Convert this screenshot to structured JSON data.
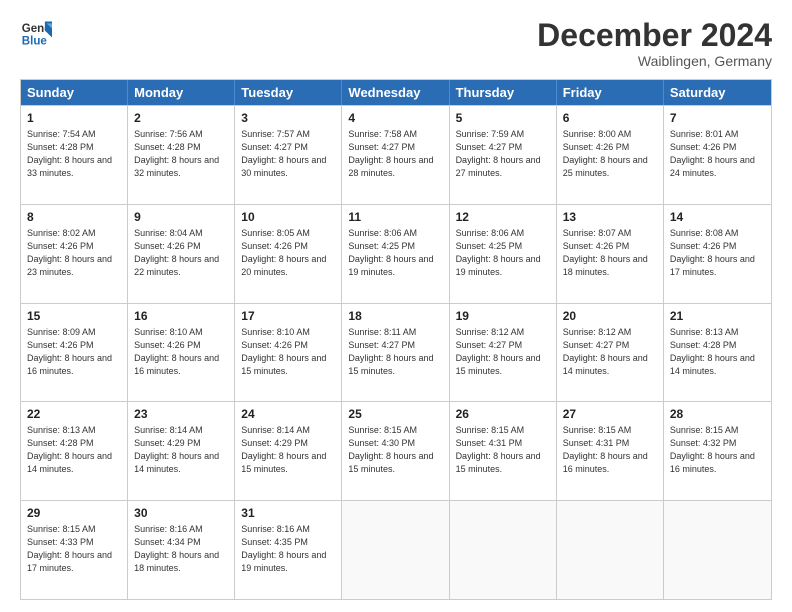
{
  "logo": {
    "line1": "General",
    "line2": "Blue"
  },
  "title": "December 2024",
  "subtitle": "Waiblingen, Germany",
  "header": {
    "days": [
      "Sunday",
      "Monday",
      "Tuesday",
      "Wednesday",
      "Thursday",
      "Friday",
      "Saturday"
    ]
  },
  "weeks": [
    [
      {
        "day": "1",
        "rise": "Sunrise: 7:54 AM",
        "set": "Sunset: 4:28 PM",
        "light": "Daylight: 8 hours and 33 minutes."
      },
      {
        "day": "2",
        "rise": "Sunrise: 7:56 AM",
        "set": "Sunset: 4:28 PM",
        "light": "Daylight: 8 hours and 32 minutes."
      },
      {
        "day": "3",
        "rise": "Sunrise: 7:57 AM",
        "set": "Sunset: 4:27 PM",
        "light": "Daylight: 8 hours and 30 minutes."
      },
      {
        "day": "4",
        "rise": "Sunrise: 7:58 AM",
        "set": "Sunset: 4:27 PM",
        "light": "Daylight: 8 hours and 28 minutes."
      },
      {
        "day": "5",
        "rise": "Sunrise: 7:59 AM",
        "set": "Sunset: 4:27 PM",
        "light": "Daylight: 8 hours and 27 minutes."
      },
      {
        "day": "6",
        "rise": "Sunrise: 8:00 AM",
        "set": "Sunset: 4:26 PM",
        "light": "Daylight: 8 hours and 25 minutes."
      },
      {
        "day": "7",
        "rise": "Sunrise: 8:01 AM",
        "set": "Sunset: 4:26 PM",
        "light": "Daylight: 8 hours and 24 minutes."
      }
    ],
    [
      {
        "day": "8",
        "rise": "Sunrise: 8:02 AM",
        "set": "Sunset: 4:26 PM",
        "light": "Daylight: 8 hours and 23 minutes."
      },
      {
        "day": "9",
        "rise": "Sunrise: 8:04 AM",
        "set": "Sunset: 4:26 PM",
        "light": "Daylight: 8 hours and 22 minutes."
      },
      {
        "day": "10",
        "rise": "Sunrise: 8:05 AM",
        "set": "Sunset: 4:26 PM",
        "light": "Daylight: 8 hours and 20 minutes."
      },
      {
        "day": "11",
        "rise": "Sunrise: 8:06 AM",
        "set": "Sunset: 4:25 PM",
        "light": "Daylight: 8 hours and 19 minutes."
      },
      {
        "day": "12",
        "rise": "Sunrise: 8:06 AM",
        "set": "Sunset: 4:25 PM",
        "light": "Daylight: 8 hours and 19 minutes."
      },
      {
        "day": "13",
        "rise": "Sunrise: 8:07 AM",
        "set": "Sunset: 4:26 PM",
        "light": "Daylight: 8 hours and 18 minutes."
      },
      {
        "day": "14",
        "rise": "Sunrise: 8:08 AM",
        "set": "Sunset: 4:26 PM",
        "light": "Daylight: 8 hours and 17 minutes."
      }
    ],
    [
      {
        "day": "15",
        "rise": "Sunrise: 8:09 AM",
        "set": "Sunset: 4:26 PM",
        "light": "Daylight: 8 hours and 16 minutes."
      },
      {
        "day": "16",
        "rise": "Sunrise: 8:10 AM",
        "set": "Sunset: 4:26 PM",
        "light": "Daylight: 8 hours and 16 minutes."
      },
      {
        "day": "17",
        "rise": "Sunrise: 8:10 AM",
        "set": "Sunset: 4:26 PM",
        "light": "Daylight: 8 hours and 15 minutes."
      },
      {
        "day": "18",
        "rise": "Sunrise: 8:11 AM",
        "set": "Sunset: 4:27 PM",
        "light": "Daylight: 8 hours and 15 minutes."
      },
      {
        "day": "19",
        "rise": "Sunrise: 8:12 AM",
        "set": "Sunset: 4:27 PM",
        "light": "Daylight: 8 hours and 15 minutes."
      },
      {
        "day": "20",
        "rise": "Sunrise: 8:12 AM",
        "set": "Sunset: 4:27 PM",
        "light": "Daylight: 8 hours and 14 minutes."
      },
      {
        "day": "21",
        "rise": "Sunrise: 8:13 AM",
        "set": "Sunset: 4:28 PM",
        "light": "Daylight: 8 hours and 14 minutes."
      }
    ],
    [
      {
        "day": "22",
        "rise": "Sunrise: 8:13 AM",
        "set": "Sunset: 4:28 PM",
        "light": "Daylight: 8 hours and 14 minutes."
      },
      {
        "day": "23",
        "rise": "Sunrise: 8:14 AM",
        "set": "Sunset: 4:29 PM",
        "light": "Daylight: 8 hours and 14 minutes."
      },
      {
        "day": "24",
        "rise": "Sunrise: 8:14 AM",
        "set": "Sunset: 4:29 PM",
        "light": "Daylight: 8 hours and 15 minutes."
      },
      {
        "day": "25",
        "rise": "Sunrise: 8:15 AM",
        "set": "Sunset: 4:30 PM",
        "light": "Daylight: 8 hours and 15 minutes."
      },
      {
        "day": "26",
        "rise": "Sunrise: 8:15 AM",
        "set": "Sunset: 4:31 PM",
        "light": "Daylight: 8 hours and 15 minutes."
      },
      {
        "day": "27",
        "rise": "Sunrise: 8:15 AM",
        "set": "Sunset: 4:31 PM",
        "light": "Daylight: 8 hours and 16 minutes."
      },
      {
        "day": "28",
        "rise": "Sunrise: 8:15 AM",
        "set": "Sunset: 4:32 PM",
        "light": "Daylight: 8 hours and 16 minutes."
      }
    ],
    [
      {
        "day": "29",
        "rise": "Sunrise: 8:15 AM",
        "set": "Sunset: 4:33 PM",
        "light": "Daylight: 8 hours and 17 minutes."
      },
      {
        "day": "30",
        "rise": "Sunrise: 8:16 AM",
        "set": "Sunset: 4:34 PM",
        "light": "Daylight: 8 hours and 18 minutes."
      },
      {
        "day": "31",
        "rise": "Sunrise: 8:16 AM",
        "set": "Sunset: 4:35 PM",
        "light": "Daylight: 8 hours and 19 minutes."
      },
      {
        "day": "",
        "rise": "",
        "set": "",
        "light": ""
      },
      {
        "day": "",
        "rise": "",
        "set": "",
        "light": ""
      },
      {
        "day": "",
        "rise": "",
        "set": "",
        "light": ""
      },
      {
        "day": "",
        "rise": "",
        "set": "",
        "light": ""
      }
    ]
  ]
}
